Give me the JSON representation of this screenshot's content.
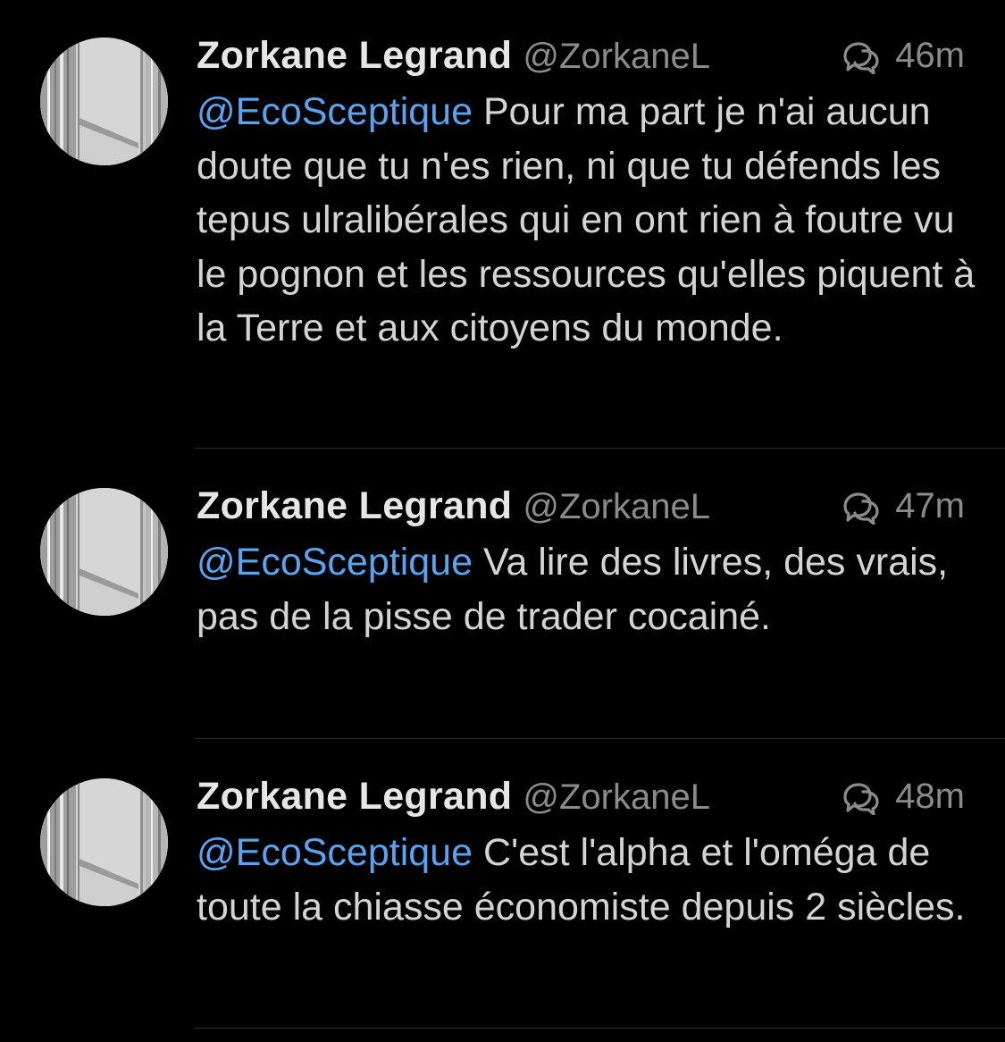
{
  "tweets": [
    {
      "display_name": "Zorkane Legrand",
      "handle": "@ZorkaneL",
      "time": "46m",
      "mention": "@EcoSceptique",
      "text": "Pour ma part je n'ai aucun doute que tu n'es rien, ni que tu défends les tepus ulralibérales qui en ont rien à foutre vu le pognon et les ressources qu'elles piquent à la Terre et aux citoyens du monde."
    },
    {
      "display_name": "Zorkane Legrand",
      "handle": "@ZorkaneL",
      "time": "47m",
      "mention": "@EcoSceptique",
      "text": "Va lire des livres, des vrais, pas de la pisse de trader cocainé."
    },
    {
      "display_name": "Zorkane Legrand",
      "handle": "@ZorkaneL",
      "time": "48m",
      "mention": "@EcoSceptique",
      "text": "C'est l'alpha et l'oméga de toute la chiasse économiste depuis 2 siècles."
    }
  ],
  "icons": {
    "conversation": "conversation-icon",
    "avatar": "avatar-photo"
  },
  "colors": {
    "background": "#000000",
    "mention": "#5aa3f0",
    "name": "#e6e6e6",
    "secondary": "#8b8b8b"
  }
}
